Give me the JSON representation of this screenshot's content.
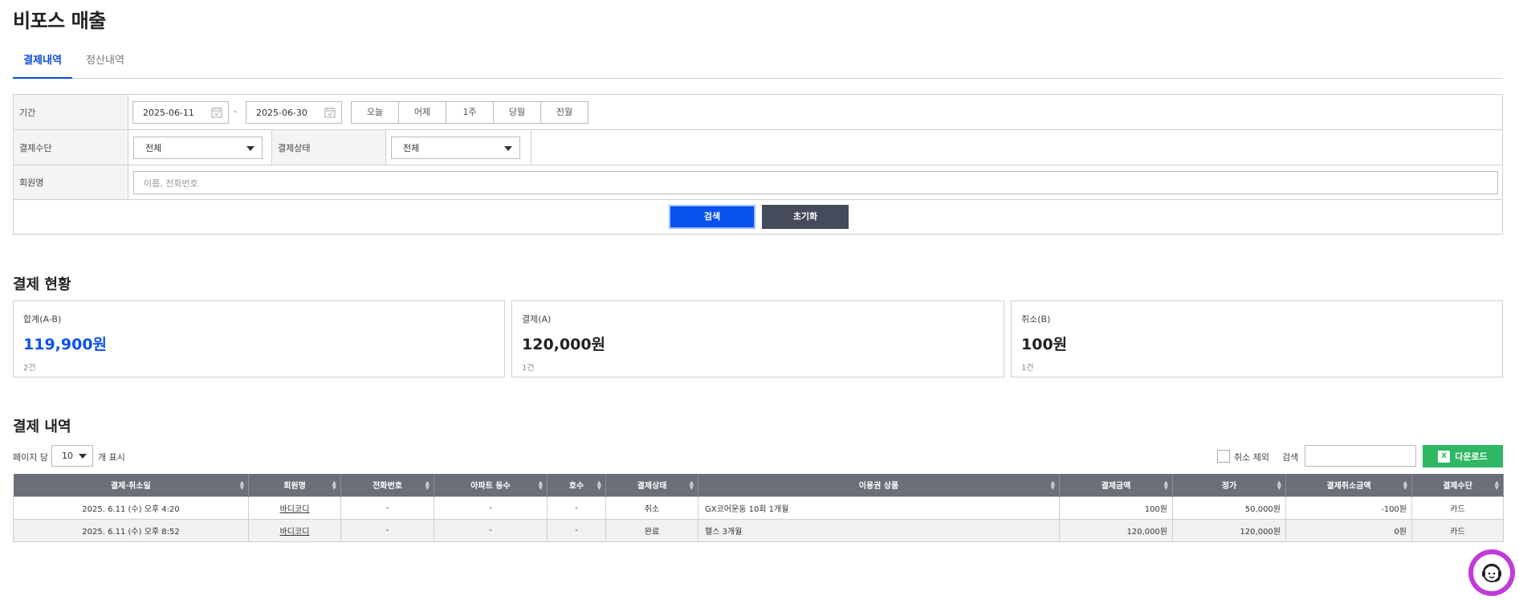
{
  "page": {
    "title": "비포스 매출"
  },
  "tabs": [
    {
      "label": "결제내역",
      "active": true
    },
    {
      "label": "정산내역",
      "active": false
    }
  ],
  "filter": {
    "period_label": "기간",
    "date_from": "2025-06-11",
    "date_separator": "-",
    "date_to": "2025-06-30",
    "quick_ranges": [
      "오늘",
      "어제",
      "1주",
      "당월",
      "전월"
    ],
    "payment_method_label": "결제수단",
    "payment_method_value": "전체",
    "payment_status_label": "결제상태",
    "payment_status_value": "전체",
    "member_label": "회원명",
    "member_placeholder": "이름, 전화번호",
    "search_button": "검색",
    "reset_button": "초기화"
  },
  "summary": {
    "title": "결제 현황",
    "cards": [
      {
        "label": "합계(A-B)",
        "amount": "119,900원",
        "count": "2건",
        "accent": "#0a52f0"
      },
      {
        "label": "결제(A)",
        "amount": "120,000원",
        "count": "1건"
      },
      {
        "label": "취소(B)",
        "amount": "100원",
        "count": "1건"
      }
    ]
  },
  "history": {
    "title": "결제 내역",
    "per_page_label": "페이지 당",
    "per_page_value": "10",
    "per_page_suffix": "개 표시",
    "exclude_cancel_label": "취소 제외",
    "search_label": "검색",
    "download_button": "다운로드",
    "download_icon_text": "X",
    "columns": [
      "결제·취소일",
      "회원명",
      "전화번호",
      "아파트 동수",
      "호수",
      "결제상태",
      "이용권 상품",
      "결제금액",
      "정가",
      "결제취소금액",
      "결제수단"
    ],
    "rows": [
      {
        "date": "2025. 6.11 (수) 오후 4:20",
        "member": "바디코디",
        "phone": "-",
        "building": "-",
        "unit": "-",
        "status": "취소",
        "product": "GX코어운동 10회 1개월",
        "amount": "100원",
        "price": "50,000원",
        "cancel_amount": "-100원",
        "method": "카드"
      },
      {
        "date": "2025. 6.11 (수) 오후 8:52",
        "member": "바디코디",
        "phone": "-",
        "building": "-",
        "unit": "-",
        "status": "완료",
        "product": "헬스 3개월",
        "amount": "120,000원",
        "price": "120,000원",
        "cancel_amount": "0원",
        "method": "카드"
      }
    ]
  },
  "colors": {
    "primary": "#0a52f0",
    "dark_button": "#454b5a",
    "download_green": "#2fb863",
    "status_cancel": "#e03131",
    "status_done": "#2fb863",
    "helper_purple": "#c13bd8"
  }
}
